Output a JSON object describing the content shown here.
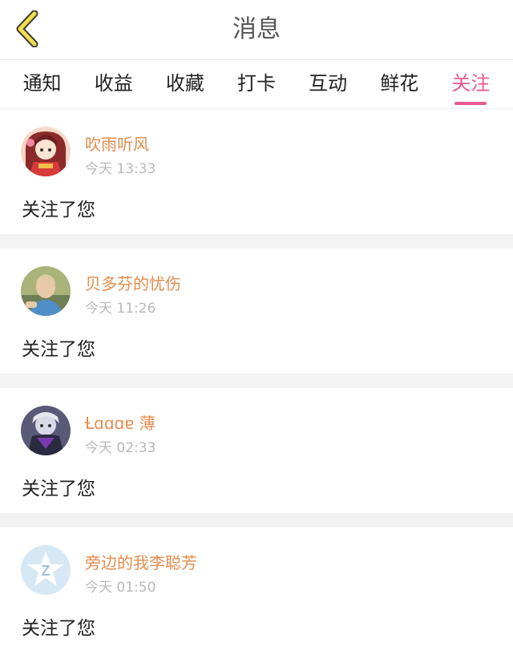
{
  "header": {
    "title": "消息"
  },
  "tabs": [
    {
      "label": "通知"
    },
    {
      "label": "收益"
    },
    {
      "label": "收藏"
    },
    {
      "label": "打卡"
    },
    {
      "label": "互动"
    },
    {
      "label": "鲜花"
    },
    {
      "label": "关注"
    }
  ],
  "active_tab": "关注",
  "accent_color": "#e85a91",
  "name_color": "#e38c4c",
  "items": [
    {
      "name": "吹雨听风",
      "time": "今天 13:33",
      "message": "关注了您",
      "avatar_icon": "anime-girl-avatar"
    },
    {
      "name": "贝多芬的忧伤",
      "time": "今天 11:26",
      "message": "关注了您",
      "avatar_icon": "photo-avatar"
    },
    {
      "name": "Ɫɑɑɑɐ 薄",
      "time": "今天 02:33",
      "message": "关注了您",
      "avatar_icon": "dark-character-avatar"
    },
    {
      "name": "旁边的我李聪芳",
      "time": "今天 01:50",
      "message": "关注了您",
      "avatar_icon": "default-star-avatar"
    }
  ]
}
